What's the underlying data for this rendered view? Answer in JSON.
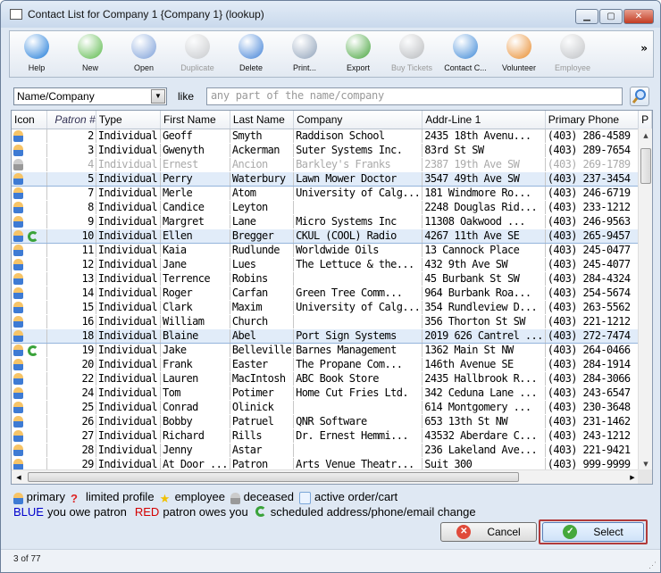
{
  "window": {
    "title": "Contact List for Company 1 {Company 1} (lookup)"
  },
  "toolbar": [
    {
      "name": "help",
      "label": "Help",
      "icon": "help-icon",
      "color": "#1a78d8",
      "disabled": false
    },
    {
      "name": "new",
      "label": "New",
      "icon": "new-document-icon",
      "color": "#58b848",
      "disabled": false
    },
    {
      "name": "open",
      "label": "Open",
      "icon": "magnifier-icon",
      "color": "#7a9ed8",
      "disabled": false
    },
    {
      "name": "duplicate",
      "label": "Duplicate",
      "icon": "duplicate-icon",
      "color": "#999999",
      "disabled": true
    },
    {
      "name": "delete",
      "label": "Delete",
      "icon": "trash-icon",
      "color": "#3d7fd6",
      "disabled": false
    },
    {
      "name": "print",
      "label": "Print...",
      "icon": "printer-icon",
      "color": "#8da0b8",
      "disabled": false
    },
    {
      "name": "export",
      "label": "Export",
      "icon": "export-icon",
      "color": "#44a33a",
      "disabled": false
    },
    {
      "name": "buy-tickets",
      "label": "Buy Tickets",
      "icon": "ticket-icon",
      "color": "#777777",
      "disabled": true
    },
    {
      "name": "contact-card",
      "label": "Contact C...",
      "icon": "contact-card-icon",
      "color": "#3a86d6",
      "disabled": false
    },
    {
      "name": "volunteer",
      "label": "Volunteer",
      "icon": "volunteer-icon",
      "color": "#e88a2a",
      "disabled": false
    },
    {
      "name": "employee",
      "label": "Employee",
      "icon": "employee-icon",
      "color": "#888888",
      "disabled": true
    }
  ],
  "search": {
    "field": "Name/Company",
    "like": "like",
    "placeholder": "any part of the name/company"
  },
  "columns": [
    "Icon",
    "Patron #",
    "Type",
    "First Name",
    "Last Name",
    "Company",
    "Addr-Line 1",
    "Primary Phone",
    "P"
  ],
  "rows": [
    {
      "icon": "primary",
      "patron": "2",
      "type": "Individual",
      "first": "Geoff",
      "last": "Smyth",
      "company": "Raddison School",
      "addr": "2435 18th Avenu...",
      "phone": "(403) 286-4589"
    },
    {
      "icon": "primary",
      "patron": "3",
      "type": "Individual",
      "first": "Gwenyth",
      "last": "Ackerman",
      "company": "Suter Systems Inc.",
      "addr": "83rd St SW",
      "phone": "(403) 289-7654"
    },
    {
      "icon": "deceased",
      "patron": "4",
      "type": "Individual",
      "first": "Ernest",
      "last": "Ancion",
      "company": "Barkley's Franks",
      "addr": "2387 19th Ave SW",
      "phone": "(403) 269-1789"
    },
    {
      "icon": "primary",
      "patron": "5",
      "type": "Individual",
      "first": "Perry",
      "last": "Waterbury",
      "company": "Lawn Mower Doctor",
      "addr": "3547 49th Ave SW",
      "phone": "(403) 237-3454",
      "highlight": true
    },
    {
      "icon": "primary",
      "patron": "7",
      "type": "Individual",
      "first": "Merle",
      "last": "Atom",
      "company": "University of Calg...",
      "addr": "181 Windmore Ro...",
      "phone": "(403) 246-6719"
    },
    {
      "icon": "primary",
      "patron": "8",
      "type": "Individual",
      "first": "Candice",
      "last": "Leyton",
      "company": "",
      "addr": "2248 Douglas Rid...",
      "phone": "(403) 233-1212"
    },
    {
      "icon": "primary",
      "patron": "9",
      "type": "Individual",
      "first": "Margret",
      "last": "Lane",
      "company": "Micro Systems Inc",
      "addr": "11308 Oakwood ...",
      "phone": "(403) 246-9563"
    },
    {
      "icon": "primary-change",
      "patron": "10",
      "type": "Individual",
      "first": "Ellen",
      "last": "Bregger",
      "company": "CKUL (COOL) Radio",
      "addr": "4267 11th Ave SE",
      "phone": "(403) 265-9457",
      "highlight": true
    },
    {
      "icon": "primary",
      "patron": "11",
      "type": "Individual",
      "first": "Kaia",
      "last": "Rudlunde",
      "company": "Worldwide Oils",
      "addr": "13 Cannock Place",
      "phone": "(403) 245-0477"
    },
    {
      "icon": "primary",
      "patron": "12",
      "type": "Individual",
      "first": "Jane",
      "last": "Lues",
      "company": "The Lettuce & the...",
      "addr": "432 9th Ave SW",
      "phone": "(403) 245-4077"
    },
    {
      "icon": "primary",
      "patron": "13",
      "type": "Individual",
      "first": "Terrence",
      "last": "Robins",
      "company": "",
      "addr": "45 Burbank St SW",
      "phone": "(403) 284-4324"
    },
    {
      "icon": "primary",
      "patron": "14",
      "type": "Individual",
      "first": "Roger",
      "last": "Carfan",
      "company": "Green Tree Comm...",
      "addr": "964 Burbank Roa...",
      "phone": "(403) 254-5674"
    },
    {
      "icon": "primary",
      "patron": "15",
      "type": "Individual",
      "first": "Clark",
      "last": "Maxim",
      "company": "University of Calg...",
      "addr": "354 Rundleview D...",
      "phone": "(403) 263-5562"
    },
    {
      "icon": "primary",
      "patron": "16",
      "type": "Individual",
      "first": "William",
      "last": "Church",
      "company": "",
      "addr": "356 Thorton St SW",
      "phone": "(403) 221-1212"
    },
    {
      "icon": "primary",
      "patron": "18",
      "type": "Individual",
      "first": "Blaine",
      "last": "Abel",
      "company": "Port Sign Systems",
      "addr": "2019 626 Cantrel ...",
      "phone": "(403) 272-7474",
      "highlight": true
    },
    {
      "icon": "primary-change",
      "patron": "19",
      "type": "Individual",
      "first": "Jake",
      "last": "Belleville",
      "company": "Barnes Management",
      "addr": "1362 Main St NW",
      "phone": "(403) 264-0466"
    },
    {
      "icon": "primary",
      "patron": "20",
      "type": "Individual",
      "first": "Frank",
      "last": "Easter",
      "company": "The Propane Com...",
      "addr": "146th Avenue SE",
      "phone": "(403) 284-1914"
    },
    {
      "icon": "primary",
      "patron": "22",
      "type": "Individual",
      "first": "Lauren",
      "last": "MacIntosh",
      "company": "ABC Book Store",
      "addr": "2435 Hallbrook R...",
      "phone": "(403) 284-3066"
    },
    {
      "icon": "primary",
      "patron": "24",
      "type": "Individual",
      "first": "Tom",
      "last": "Potimer",
      "company": "Home Cut Fries Ltd.",
      "addr": "342 Ceduna Lane ...",
      "phone": "(403) 243-6547"
    },
    {
      "icon": "primary",
      "patron": "25",
      "type": "Individual",
      "first": "Conrad",
      "last": "Olinick",
      "company": "",
      "addr": "614 Montgomery ...",
      "phone": "(403) 230-3648"
    },
    {
      "icon": "primary",
      "patron": "26",
      "type": "Individual",
      "first": "Bobby",
      "last": "Patruel",
      "company": "QNR Software",
      "addr": "653 13th St NW",
      "phone": "(403) 231-1462"
    },
    {
      "icon": "primary",
      "patron": "27",
      "type": "Individual",
      "first": "Richard",
      "last": "Rills",
      "company": "Dr. Ernest Hemmi...",
      "addr": "43532 Aberdare C...",
      "phone": "(403) 243-1212"
    },
    {
      "icon": "primary",
      "patron": "28",
      "type": "Individual",
      "first": "Jenny",
      "last": "Astar",
      "company": "",
      "addr": "236 Lakeland Ave...",
      "phone": "(403) 221-9421"
    },
    {
      "icon": "primary",
      "patron": "29",
      "type": "Individual",
      "first": "At Door ...",
      "last": "Patron",
      "company": "Arts Venue Theatr...",
      "addr": "Suit 300",
      "phone": "(403) 999-9999"
    }
  ],
  "legend": {
    "primary": "primary",
    "limited": "limited profile",
    "employee": "employee",
    "deceased": "deceased",
    "active_order": "active order/cart",
    "blue_word": "BLUE",
    "blue_text": "you owe patron",
    "red_word": "RED",
    "red_text": "patron owes you",
    "change": "scheduled address/phone/email change",
    "blue_color": "#0000cc",
    "red_color": "#d40000"
  },
  "buttons": {
    "cancel": "Cancel",
    "select": "Select"
  },
  "status": "3 of 77"
}
